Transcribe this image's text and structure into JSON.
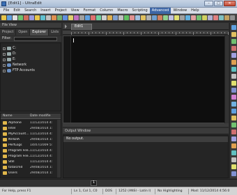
{
  "window": {
    "title": "[Edit1] - UltraEdit",
    "min_glyph": "–",
    "max_glyph": "□",
    "close_glyph": "✕"
  },
  "menu": [
    "File",
    "Edit",
    "Search",
    "Insert",
    "Project",
    "View",
    "Format",
    "Column",
    "Macro",
    "Scripting",
    "Advanced",
    "Window",
    "Help"
  ],
  "menu_active": "Advanced",
  "file_view": {
    "title": "File View",
    "tabs": [
      "Project",
      "Open",
      "Explorer",
      "Lists"
    ],
    "active_tab": "Explorer",
    "filter_label": "Filter:",
    "filter_value": "",
    "tree": [
      {
        "label": "C:",
        "kind": "drive"
      },
      {
        "label": "D:",
        "kind": "drive"
      },
      {
        "label": "E:",
        "kind": "drive"
      },
      {
        "label": "Network",
        "kind": "network"
      },
      {
        "label": "FTP Accounts",
        "kind": "network"
      }
    ]
  },
  "file_list": {
    "col_name": "Name",
    "col_date": "Date modifie",
    "rows": [
      {
        "name": "Alphone",
        "date": "11/12/2014 4:"
      },
      {
        "name": "Intel",
        "date": "29/08/2014 1:"
      },
      {
        "name": "MyAccount...",
        "date": "11/12/2014 4:"
      },
      {
        "name": "NVIDIA",
        "date": "29/08/2014 1:"
      },
      {
        "name": "PerfLogs",
        "date": "14/07/2009 5:"
      },
      {
        "name": "Program File...",
        "date": "11/12/2014 4:"
      },
      {
        "name": "Program File...",
        "date": "11/12/2014 4:"
      },
      {
        "name": "Still",
        "date": "11/12/2014 4:"
      },
      {
        "name": "totalcmd",
        "date": "29/08/2014 1:"
      },
      {
        "name": "Users",
        "date": "29/08/2014 1:"
      }
    ]
  },
  "editor": {
    "tab_label": "Edit1"
  },
  "output": {
    "title": "Output Window",
    "line": "No output."
  },
  "bottom": {
    "page": "1"
  },
  "status": {
    "help": "For Help, press F1",
    "position": "Ln 1, Col 1, C0",
    "line_ending": "DOS",
    "encoding": "1252 (ANSI - Latin I)",
    "highlighting": "No Highlighting",
    "modified": "Mod: 11/12/2014 4:56:0"
  },
  "colors": {
    "menu_active_bg": "#3d66a6",
    "editor_bg": "#0e0e0e",
    "folder": "#e0b64a"
  }
}
